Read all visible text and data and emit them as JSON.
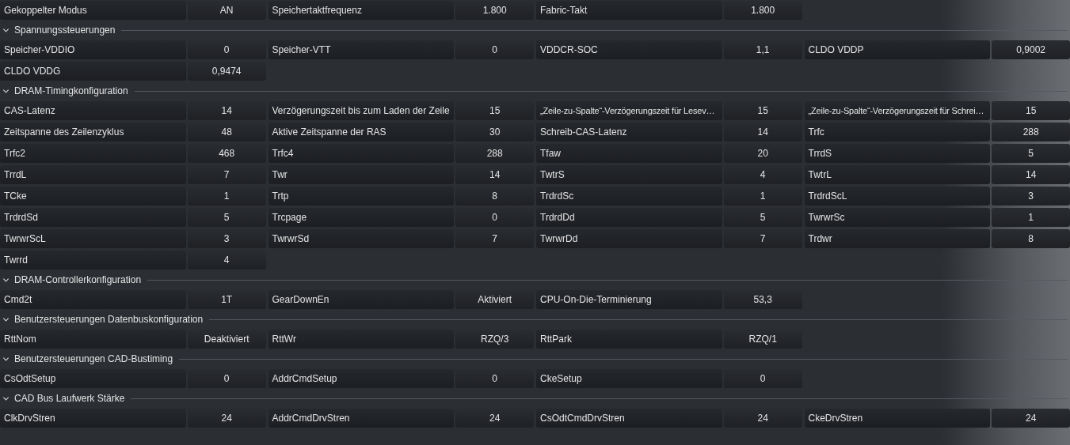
{
  "top_settings": [
    {
      "label": "Gekoppelter Modus",
      "value": "AN"
    },
    {
      "label": "Speichertaktfrequenz",
      "value": "1.800"
    },
    {
      "label": "Fabric-Takt",
      "value": "1.800"
    }
  ],
  "sections": [
    {
      "title": "Spannungssteuerungen",
      "expanded": true,
      "settings": [
        {
          "label": "Speicher-VDDIO",
          "value": "0"
        },
        {
          "label": "Speicher-VTT",
          "value": "0"
        },
        {
          "label": "VDDCR-SOC",
          "value": "1,1"
        },
        {
          "label": "CLDO VDDP",
          "value": "0,9002"
        },
        {
          "label": "CLDO VDDG",
          "value": "0,9474"
        }
      ]
    },
    {
      "title": "DRAM-Timingkonfiguration",
      "expanded": true,
      "settings": [
        {
          "label": "CAS-Latenz",
          "value": "14"
        },
        {
          "label": "Verzögerungszeit bis zum Laden der Zeile",
          "value": "15"
        },
        {
          "label": "„Zeile-zu-Spalte“-Verzögerungszeit für Lesev…",
          "value": "15"
        },
        {
          "label": "„Zeile-zu-Spalte“-Verzögerungszeit für Schrei…",
          "value": "15"
        },
        {
          "label": "Zeitspanne des Zeilenzyklus",
          "value": "48"
        },
        {
          "label": "Aktive Zeitspanne der RAS",
          "value": "30"
        },
        {
          "label": "Schreib-CAS-Latenz",
          "value": "14"
        },
        {
          "label": "Trfc",
          "value": "288"
        },
        {
          "label": "Trfc2",
          "value": "468"
        },
        {
          "label": "Trfc4",
          "value": "288"
        },
        {
          "label": "Tfaw",
          "value": "20"
        },
        {
          "label": "TrrdS",
          "value": "5"
        },
        {
          "label": "TrrdL",
          "value": "7"
        },
        {
          "label": "Twr",
          "value": "14"
        },
        {
          "label": "TwtrS",
          "value": "4"
        },
        {
          "label": "TwtrL",
          "value": "14"
        },
        {
          "label": "TCke",
          "value": "1"
        },
        {
          "label": "Trtp",
          "value": "8"
        },
        {
          "label": "TrdrdSc",
          "value": "1"
        },
        {
          "label": "TrdrdScL",
          "value": "3"
        },
        {
          "label": "TrdrdSd",
          "value": "5"
        },
        {
          "label": "Trcpage",
          "value": "0"
        },
        {
          "label": "TrdrdDd",
          "value": "5"
        },
        {
          "label": "TwrwrSc",
          "value": "1"
        },
        {
          "label": "TwrwrScL",
          "value": "3"
        },
        {
          "label": "TwrwrSd",
          "value": "7"
        },
        {
          "label": "TwrwrDd",
          "value": "7"
        },
        {
          "label": "Trdwr",
          "value": "8"
        },
        {
          "label": "Twrrd",
          "value": "4"
        }
      ]
    },
    {
      "title": "DRAM-Controllerkonfiguration",
      "expanded": true,
      "settings": [
        {
          "label": "Cmd2t",
          "value": "1T"
        },
        {
          "label": "GearDownEn",
          "value": "Aktiviert"
        },
        {
          "label": "CPU-On-Die-Terminierung",
          "value": "53,3"
        }
      ]
    },
    {
      "title": "Benutzersteuerungen Datenbuskonfiguration",
      "expanded": true,
      "settings": [
        {
          "label": "RttNom",
          "value": "Deaktiviert"
        },
        {
          "label": "RttWr",
          "value": "RZQ/3"
        },
        {
          "label": "RttPark",
          "value": "RZQ/1"
        }
      ]
    },
    {
      "title": "Benutzersteuerungen CAD-Bustiming",
      "expanded": true,
      "settings": [
        {
          "label": "CsOdtSetup",
          "value": "0"
        },
        {
          "label": "AddrCmdSetup",
          "value": "0"
        },
        {
          "label": "CkeSetup",
          "value": "0"
        }
      ]
    },
    {
      "title": "CAD Bus Laufwerk Stärke",
      "expanded": true,
      "settings": [
        {
          "label": "ClkDrvStren",
          "value": "24"
        },
        {
          "label": "AddrCmdDrvStren",
          "value": "24"
        },
        {
          "label": "CsOdtCmdDrvStren",
          "value": "24"
        },
        {
          "label": "CkeDrvStren",
          "value": "24"
        }
      ]
    }
  ]
}
